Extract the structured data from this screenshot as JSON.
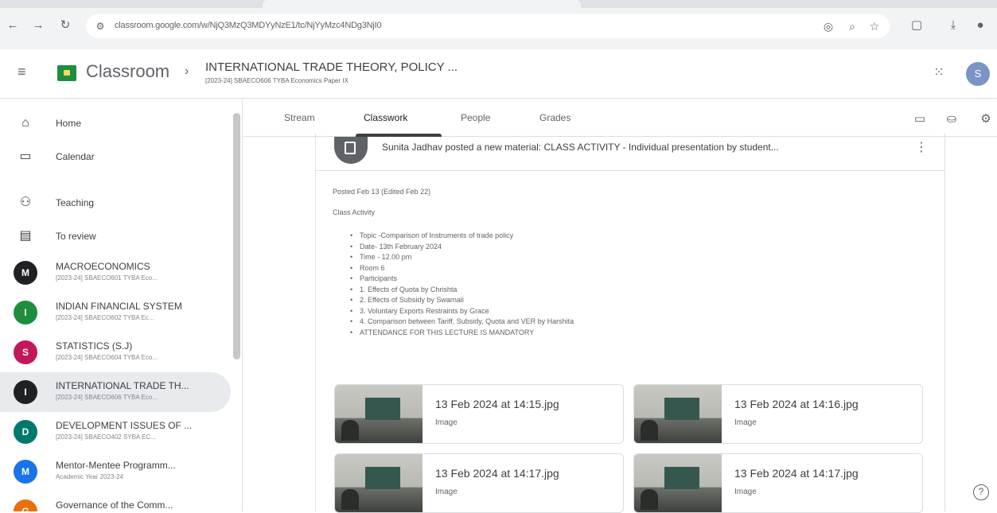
{
  "browser": {
    "url": "classroom.google.com/w/NjQ3MzQ3MDYyNzE1/tc/NjYyMzc4NDg3NjI0",
    "back_glyph": "←",
    "forward_glyph": "→",
    "reload_glyph": "↻"
  },
  "header": {
    "app_name": "Classroom",
    "separator": "›",
    "class_title": "INTERNATIONAL TRADE THEORY, POLICY ...",
    "class_subtitle": "[2023-24] SBAECO606 TYBA Economics Paper IX",
    "avatar_letter": "S"
  },
  "sidebar": {
    "nav": [
      {
        "label": "Home",
        "icon": "home-icon"
      },
      {
        "label": "Calendar",
        "icon": "calendar-icon"
      },
      {
        "label": "Teaching",
        "icon": "teaching-icon"
      },
      {
        "label": "To review",
        "icon": "to-review-icon"
      }
    ],
    "classes": [
      {
        "letter": "M",
        "name": "MACROECONOMICS",
        "sub": "[2023-24] SBAECO601 TYBA Eco...",
        "color": "#202124"
      },
      {
        "letter": "I",
        "name": "INDIAN FINANCIAL SYSTEM",
        "sub": "[2023-24] SBAECO602 TYBA Ec...",
        "color": "#1e8e3e"
      },
      {
        "letter": "S",
        "name": "STATISTICS (S.J)",
        "sub": "[2023-24] SBAECO604 TYBA Eco...",
        "color": "#c2185b"
      },
      {
        "letter": "I",
        "name": "INTERNATIONAL TRADE TH...",
        "sub": "[2023-24] SBAECO606 TYBA Eco...",
        "color": "#202124"
      },
      {
        "letter": "D",
        "name": "DEVELOPMENT ISSUES OF ...",
        "sub": "[2023-24] SBAECO402 SYBA EC...",
        "color": "#00796b"
      },
      {
        "letter": "M",
        "name": "Mentor-Mentee Programm...",
        "sub": "Academic Year 2023-24",
        "color": "#1a73e8"
      },
      {
        "letter": "G",
        "name": "Governance of the Comm...",
        "sub": "",
        "color": "#e8710a"
      }
    ]
  },
  "tabs": [
    {
      "label": "Stream"
    },
    {
      "label": "Classwork"
    },
    {
      "label": "People"
    },
    {
      "label": "Grades"
    }
  ],
  "post": {
    "header": "Sunita Jadhav posted a new material: CLASS ACTIVITY - Individual presentation by student...",
    "posted": "Posted Feb 13 (Edited Feb 22)",
    "lead": "Class Activity",
    "bullets": [
      "Topic -Comparison of Instruments of trade policy",
      "Date- 13th February 2024",
      "Time - 12.00 pm",
      "Room 6",
      "Participants",
      "1. Effects of Quota by Chrishta",
      "2. Effects of Subsidy by Swarnali",
      "3. Voluntary Exports Restraints by Grace",
      "4. Comparison between Tariff, Subsidy, Quota and VER by Harshita",
      "ATTENDANCE FOR THIS LECTURE IS MANDATORY"
    ],
    "bullet_glyph": "•"
  },
  "attachments": [
    {
      "name": "13 Feb 2024 at 14:15.jpg",
      "type": "Image"
    },
    {
      "name": "13 Feb 2024 at 14:16.jpg",
      "type": "Image"
    },
    {
      "name": "13 Feb 2024 at 14:17.jpg",
      "type": "Image"
    },
    {
      "name": "13 Feb 2024 at 14:17.jpg",
      "type": "Image"
    }
  ],
  "help_glyph": "?"
}
